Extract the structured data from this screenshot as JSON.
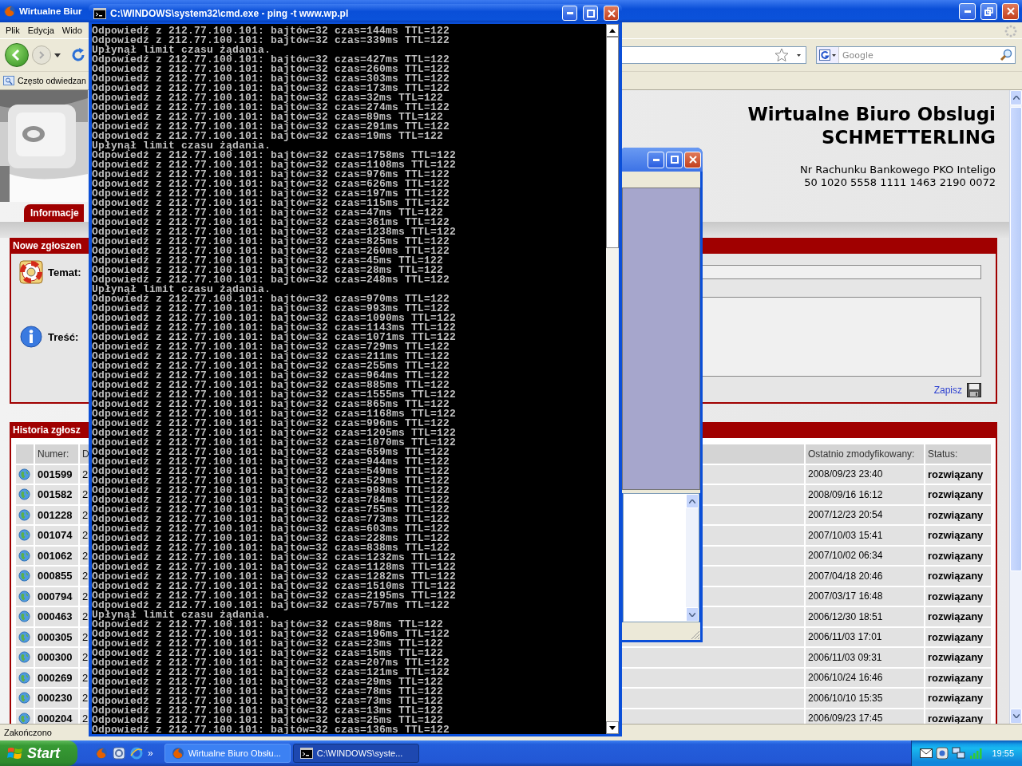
{
  "browser": {
    "title": "Wirtualne Biur",
    "menu": [
      "Plik",
      "Edycja",
      "Wido"
    ],
    "bookmarks": [
      "Często odwiedzan"
    ],
    "search": {
      "placeholder": "Google"
    },
    "page": {
      "title": "Wirtualne Biuro Obslugi",
      "subtitle": "SCHMETTERLING",
      "account_label": "Nr Rachunku Bankowego PKO Inteligo",
      "account_number": "50 1020 5558 1111 1463 2190 0072",
      "tabs": [
        {
          "label": "Informacje",
          "selected": true
        }
      ],
      "new_ticket": {
        "title": "Nowe zgłoszen",
        "fields": [
          {
            "label": "Temat:",
            "kind": "line"
          },
          {
            "label": "Treść:",
            "kind": "area"
          }
        ],
        "save_link": "Zapisz"
      },
      "history": {
        "title": "Historia zgłosz",
        "columns": [
          "Numer:",
          "D",
          "Ostatnio zmodyfikowany:",
          "Status:"
        ],
        "rows": [
          {
            "number": "001599",
            "column_2": "2",
            "modified": "2008/09/23 23:40",
            "status": "rozwiązany"
          },
          {
            "number": "001582",
            "column_2": "2",
            "modified": "2008/09/16 16:12",
            "status": "rozwiązany"
          },
          {
            "number": "001228",
            "column_2": "2",
            "modified": "2007/12/23 20:54",
            "status": "rozwiązany"
          },
          {
            "number": "001074",
            "column_2": "2",
            "modified": "2007/10/03 15:41",
            "status": "rozwiązany"
          },
          {
            "number": "001062",
            "column_2": "2",
            "modified": "2007/10/02 06:34",
            "status": "rozwiązany"
          },
          {
            "number": "000855",
            "column_2": "2",
            "modified": "2007/04/18 20:46",
            "status": "rozwiązany"
          },
          {
            "number": "000794",
            "column_2": "2",
            "modified": "2007/03/17 16:48",
            "status": "rozwiązany"
          },
          {
            "number": "000463",
            "column_2": "2",
            "modified": "2006/12/30 18:51",
            "status": "rozwiązany"
          },
          {
            "number": "000305",
            "column_2": "2",
            "modified": "2006/11/03 17:01",
            "status": "rozwiązany"
          },
          {
            "number": "000300",
            "column_2": "2",
            "modified": "2006/11/03 09:31",
            "status": "rozwiązany"
          },
          {
            "number": "000269",
            "column_2": "2",
            "modified": "2006/10/24 16:46",
            "status": "rozwiązany"
          },
          {
            "number": "000230",
            "column_2": "2",
            "modified": "2006/10/10 15:35",
            "status": "rozwiązany"
          },
          {
            "number": "000204",
            "column_2": "2",
            "modified": "2006/09/23 17:45",
            "status": "rozwiązany"
          }
        ]
      }
    },
    "status_bar": "Zakończono"
  },
  "cmd": {
    "title": "C:\\WINDOWS\\system32\\cmd.exe - ping -t www.wp.pl",
    "lines": [
      "Odpowiedź z 212.77.100.101: bajtów=32 czas=144ms TTL=122",
      "Odpowiedź z 212.77.100.101: bajtów=32 czas=339ms TTL=122",
      "Upłynął limit czasu żądania.",
      "Odpowiedź z 212.77.100.101: bajtów=32 czas=427ms TTL=122",
      "Odpowiedź z 212.77.100.101: bajtów=32 czas=260ms TTL=122",
      "Odpowiedź z 212.77.100.101: bajtów=32 czas=303ms TTL=122",
      "Odpowiedź z 212.77.100.101: bajtów=32 czas=173ms TTL=122",
      "Odpowiedź z 212.77.100.101: bajtów=32 czas=32ms TTL=122",
      "Odpowiedź z 212.77.100.101: bajtów=32 czas=274ms TTL=122",
      "Odpowiedź z 212.77.100.101: bajtów=32 czas=89ms TTL=122",
      "Odpowiedź z 212.77.100.101: bajtów=32 czas=291ms TTL=122",
      "Odpowiedź z 212.77.100.101: bajtów=32 czas=19ms TTL=122",
      "Upłynął limit czasu żądania.",
      "Odpowiedź z 212.77.100.101: bajtów=32 czas=1758ms TTL=122",
      "Odpowiedź z 212.77.100.101: bajtów=32 czas=1108ms TTL=122",
      "Odpowiedź z 212.77.100.101: bajtów=32 czas=976ms TTL=122",
      "Odpowiedź z 212.77.100.101: bajtów=32 czas=626ms TTL=122",
      "Odpowiedź z 212.77.100.101: bajtów=32 czas=197ms TTL=122",
      "Odpowiedź z 212.77.100.101: bajtów=32 czas=115ms TTL=122",
      "Odpowiedź z 212.77.100.101: bajtów=32 czas=47ms TTL=122",
      "Odpowiedź z 212.77.100.101: bajtów=32 czas=361ms TTL=122",
      "Odpowiedź z 212.77.100.101: bajtów=32 czas=1238ms TTL=122",
      "Odpowiedź z 212.77.100.101: bajtów=32 czas=825ms TTL=122",
      "Odpowiedź z 212.77.100.101: bajtów=32 czas=260ms TTL=122",
      "Odpowiedź z 212.77.100.101: bajtów=32 czas=45ms TTL=122",
      "Odpowiedź z 212.77.100.101: bajtów=32 czas=28ms TTL=122",
      "Odpowiedź z 212.77.100.101: bajtów=32 czas=248ms TTL=122",
      "Upłynął limit czasu żądania.",
      "Odpowiedź z 212.77.100.101: bajtów=32 czas=970ms TTL=122",
      "Odpowiedź z 212.77.100.101: bajtów=32 czas=993ms TTL=122",
      "Odpowiedź z 212.77.100.101: bajtów=32 czas=1090ms TTL=122",
      "Odpowiedź z 212.77.100.101: bajtów=32 czas=1143ms TTL=122",
      "Odpowiedź z 212.77.100.101: bajtów=32 czas=1071ms TTL=122",
      "Odpowiedź z 212.77.100.101: bajtów=32 czas=729ms TTL=122",
      "Odpowiedź z 212.77.100.101: bajtów=32 czas=211ms TTL=122",
      "Odpowiedź z 212.77.100.101: bajtów=32 czas=255ms TTL=122",
      "Odpowiedź z 212.77.100.101: bajtów=32 czas=964ms TTL=122",
      "Odpowiedź z 212.77.100.101: bajtów=32 czas=885ms TTL=122",
      "Odpowiedź z 212.77.100.101: bajtów=32 czas=1555ms TTL=122",
      "Odpowiedź z 212.77.100.101: bajtów=32 czas=865ms TTL=122",
      "Odpowiedź z 212.77.100.101: bajtów=32 czas=1168ms TTL=122",
      "Odpowiedź z 212.77.100.101: bajtów=32 czas=996ms TTL=122",
      "Odpowiedź z 212.77.100.101: bajtów=32 czas=1205ms TTL=122",
      "Odpowiedź z 212.77.100.101: bajtów=32 czas=1070ms TTL=122",
      "Odpowiedź z 212.77.100.101: bajtów=32 czas=659ms TTL=122",
      "Odpowiedź z 212.77.100.101: bajtów=32 czas=944ms TTL=122",
      "Odpowiedź z 212.77.100.101: bajtów=32 czas=549ms TTL=122",
      "Odpowiedź z 212.77.100.101: bajtów=32 czas=529ms TTL=122",
      "Odpowiedź z 212.77.100.101: bajtów=32 czas=998ms TTL=122",
      "Odpowiedź z 212.77.100.101: bajtów=32 czas=784ms TTL=122",
      "Odpowiedź z 212.77.100.101: bajtów=32 czas=755ms TTL=122",
      "Odpowiedź z 212.77.100.101: bajtów=32 czas=773ms TTL=122",
      "Odpowiedź z 212.77.100.101: bajtów=32 czas=603ms TTL=122",
      "Odpowiedź z 212.77.100.101: bajtów=32 czas=228ms TTL=122",
      "Odpowiedź z 212.77.100.101: bajtów=32 czas=838ms TTL=122",
      "Odpowiedź z 212.77.100.101: bajtów=32 czas=1232ms TTL=122",
      "Odpowiedź z 212.77.100.101: bajtów=32 czas=1128ms TTL=122",
      "Odpowiedź z 212.77.100.101: bajtów=32 czas=1282ms TTL=122",
      "Odpowiedź z 212.77.100.101: bajtów=32 czas=1510ms TTL=122",
      "Odpowiedź z 212.77.100.101: bajtów=32 czas=2195ms TTL=122",
      "Odpowiedź z 212.77.100.101: bajtów=32 czas=757ms TTL=122",
      "Upłynął limit czasu żądania.",
      "Odpowiedź z 212.77.100.101: bajtów=32 czas=98ms TTL=122",
      "Odpowiedź z 212.77.100.101: bajtów=32 czas=196ms TTL=122",
      "Odpowiedź z 212.77.100.101: bajtów=32 czas=23ms TTL=122",
      "Odpowiedź z 212.77.100.101: bajtów=32 czas=15ms TTL=122",
      "Odpowiedź z 212.77.100.101: bajtów=32 czas=207ms TTL=122",
      "Odpowiedź z 212.77.100.101: bajtów=32 czas=121ms TTL=122",
      "Odpowiedź z 212.77.100.101: bajtów=32 czas=29ms TTL=122",
      "Odpowiedź z 212.77.100.101: bajtów=32 czas=78ms TTL=122",
      "Odpowiedź z 212.77.100.101: bajtów=32 czas=73ms TTL=122",
      "Odpowiedź z 212.77.100.101: bajtów=32 czas=13ms TTL=122",
      "Odpowiedź z 212.77.100.101: bajtów=32 czas=25ms TTL=122",
      "Odpowiedź z 212.77.100.101: bajtów=32 czas=136ms TTL=122"
    ]
  },
  "taskbar": {
    "start": "Start",
    "overflow": "»",
    "tasks": [
      {
        "label": "Wirtualne Biuro Obsłu...",
        "kind": "browser",
        "selected": false
      },
      {
        "label": "C:\\WINDOWS\\syste...",
        "kind": "console",
        "selected": true
      }
    ],
    "clock": "19:55"
  }
}
